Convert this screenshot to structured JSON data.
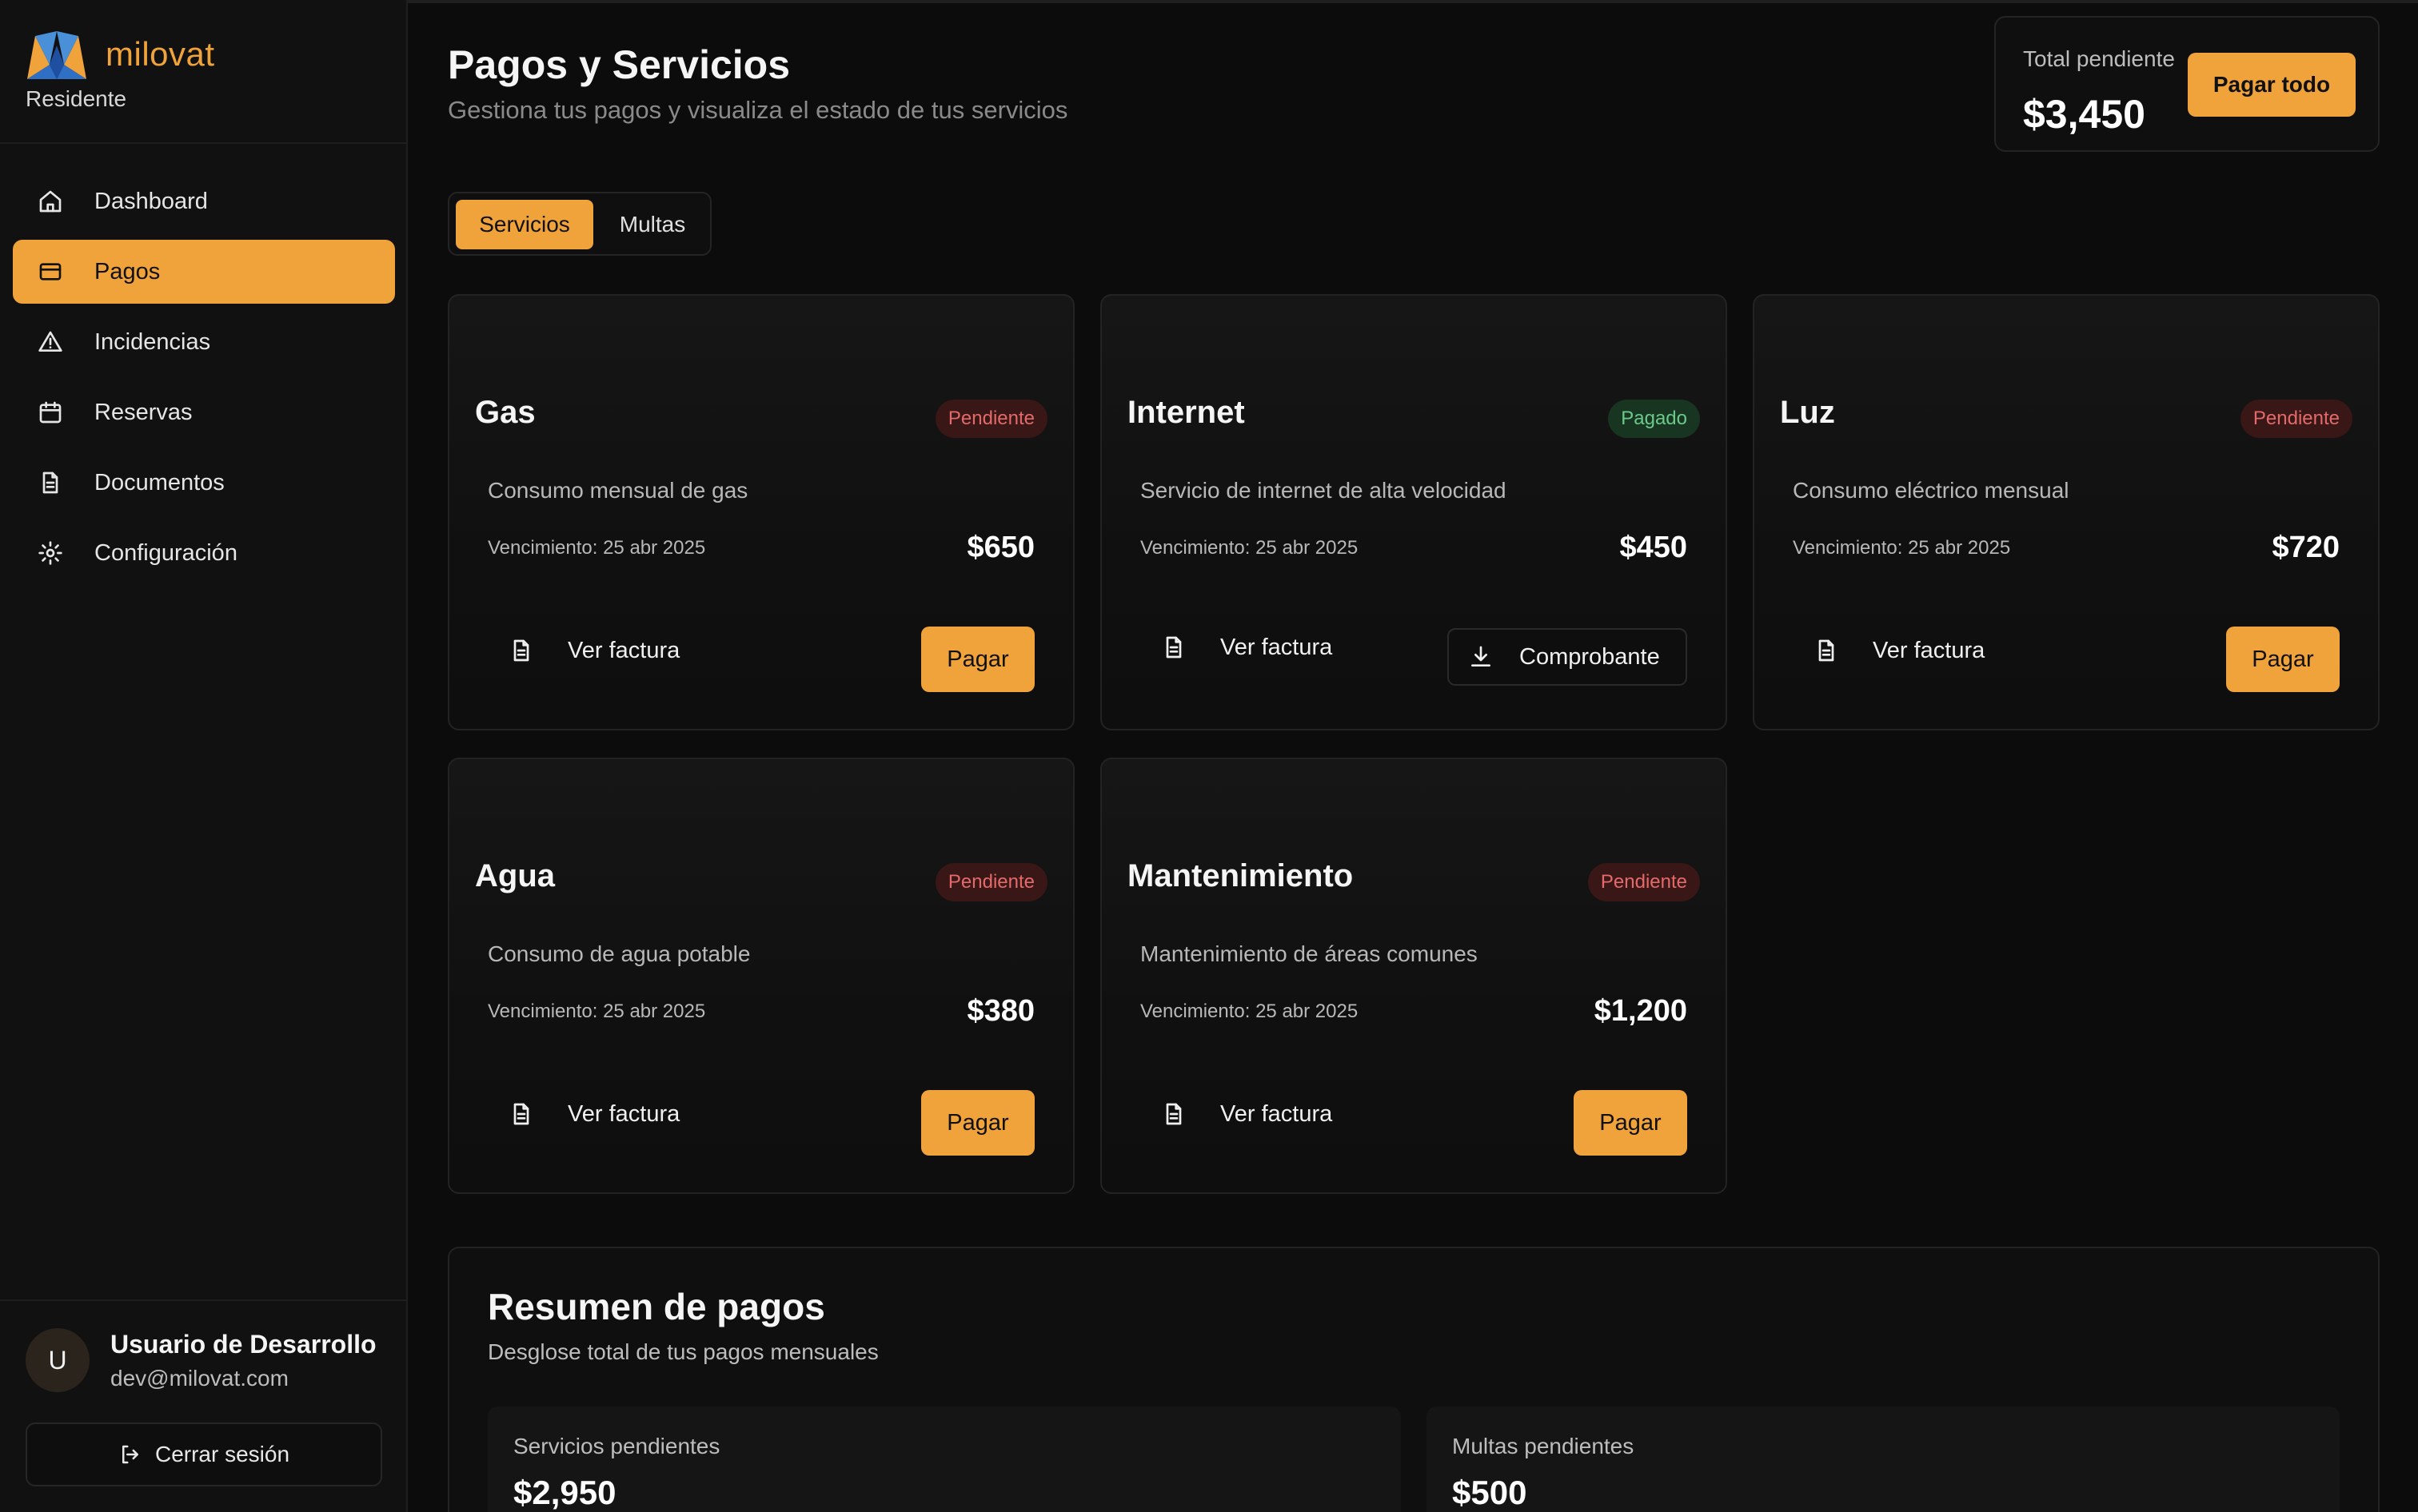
{
  "brand": {
    "name": "milovat",
    "role": "Residente"
  },
  "sidebar": {
    "items": [
      {
        "label": "Dashboard",
        "icon": "home-icon",
        "active": false
      },
      {
        "label": "Pagos",
        "icon": "credit-card-icon",
        "active": true
      },
      {
        "label": "Incidencias",
        "icon": "alert-triangle-icon",
        "active": false
      },
      {
        "label": "Reservas",
        "icon": "calendar-icon",
        "active": false
      },
      {
        "label": "Documentos",
        "icon": "file-text-icon",
        "active": false
      },
      {
        "label": "Configuración",
        "icon": "settings-icon",
        "active": false
      }
    ]
  },
  "user": {
    "initial": "U",
    "name": "Usuario de Desarrollo",
    "email": "dev@milovat.com",
    "logout_label": "Cerrar sesión"
  },
  "header": {
    "title": "Pagos y Servicios",
    "subtitle": "Gestiona tus pagos y visualiza el estado de tus servicios",
    "total_label": "Total pendiente",
    "total_amount": "$3,450",
    "pay_all_label": "Pagar todo"
  },
  "tabs": [
    {
      "label": "Servicios",
      "active": true
    },
    {
      "label": "Multas",
      "active": false
    }
  ],
  "services": [
    {
      "title": "Gas",
      "status": "Pendiente",
      "status_type": "pending",
      "description": "Consumo mensual de gas",
      "due": "Vencimiento: 25 abr 2025",
      "amount": "$650",
      "invoice_label": "Ver factura",
      "action_label": "Pagar"
    },
    {
      "title": "Internet",
      "status": "Pagado",
      "status_type": "paid",
      "description": "Servicio de internet de alta velocidad",
      "due": "Vencimiento: 25 abr 2025",
      "amount": "$450",
      "invoice_label": "Ver factura",
      "action_label": "Comprobante"
    },
    {
      "title": "Luz",
      "status": "Pendiente",
      "status_type": "pending",
      "description": "Consumo eléctrico mensual",
      "due": "Vencimiento: 25 abr 2025",
      "amount": "$720",
      "invoice_label": "Ver factura",
      "action_label": "Pagar"
    },
    {
      "title": "Agua",
      "status": "Pendiente",
      "status_type": "pending",
      "description": "Consumo de agua potable",
      "due": "Vencimiento: 25 abr 2025",
      "amount": "$380",
      "invoice_label": "Ver factura",
      "action_label": "Pagar"
    },
    {
      "title": "Mantenimiento",
      "status": "Pendiente",
      "status_type": "pending",
      "description": "Mantenimiento de áreas comunes",
      "due": "Vencimiento: 25 abr 2025",
      "amount": "$1,200",
      "invoice_label": "Ver factura",
      "action_label": "Pagar"
    }
  ],
  "summary": {
    "title": "Resumen de pagos",
    "subtitle": "Desglose total de tus pagos mensuales",
    "services_label": "Servicios pendientes",
    "services_value": "$2,950",
    "fines_label": "Multas pendientes",
    "fines_value": "$500"
  },
  "colors": {
    "accent": "#f0a23b",
    "background": "#0c0c0c",
    "pending": "#e36a6a",
    "paid": "#6bc98a"
  }
}
